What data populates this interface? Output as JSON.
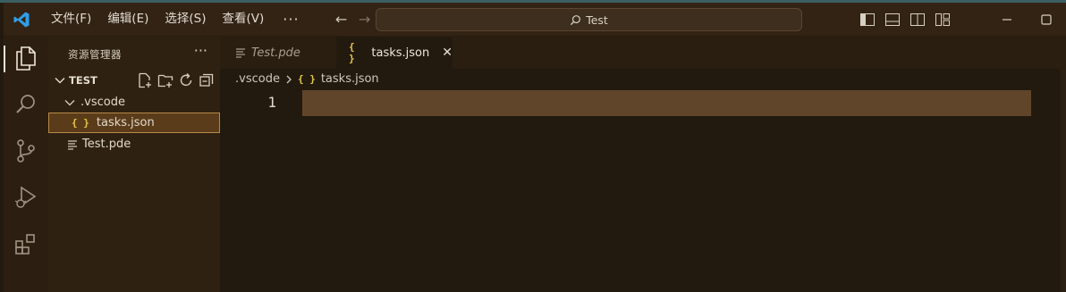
{
  "menu": {
    "items": [
      "文件(F)",
      "编辑(E)",
      "选择(S)",
      "查看(V)"
    ],
    "more": "···"
  },
  "search": {
    "text": "Test"
  },
  "sidebar": {
    "title": "资源管理器",
    "more": "···",
    "folder": "TEST",
    "tree": [
      {
        "label": ".vscode",
        "type": "folder"
      },
      {
        "label": "tasks.json",
        "type": "json",
        "selected": true
      },
      {
        "label": "Test.pde",
        "type": "file"
      }
    ]
  },
  "tabs": [
    {
      "label": "Test.pde",
      "active": false
    },
    {
      "label": "tasks.json",
      "active": true
    }
  ],
  "breadcrumb": {
    "folder": ".vscode",
    "file": "tasks.json"
  },
  "editor": {
    "line_numbers": [
      "1"
    ]
  },
  "icons": {
    "json": "{ }",
    "close": "✕",
    "back": "←",
    "forward": "→"
  },
  "colors": {
    "accent": "#e8c84a",
    "selection": "#5a3c1a",
    "current_line": "#61452a"
  }
}
